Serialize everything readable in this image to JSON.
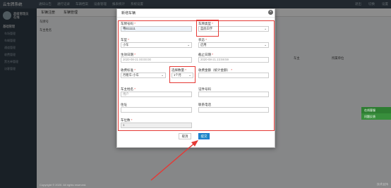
{
  "app": {
    "brand": "云车牌系统",
    "top_nav": [
      "通知公告",
      "通行记录",
      "车辆档案",
      "设备管理",
      "报表统计",
      "系统设置"
    ],
    "top_right": [
      "退出",
      "切换",
      "设置"
    ]
  },
  "sidebar": {
    "user_name": "超级管理员",
    "user_status": "在线",
    "section": "基础管理",
    "items": [
      "车场管理",
      "车辆管理",
      "通道管理",
      "收费管理",
      "黑名单管理",
      "访客管理"
    ]
  },
  "tabs": [
    "车辆注册",
    "车辆管理"
  ],
  "background": {
    "labels": [
      "车牌号",
      "车主姓名",
      "车主",
      "所属单位"
    ],
    "footer_left": "Copyright © 2020. All rights reserved.",
    "footer_right": "技术支持"
  },
  "float_buttons": [
    "在线客服",
    "问题反馈"
  ],
  "modal": {
    "title": "新增车辆",
    "close_glyph": "×",
    "fields": {
      "plate": {
        "label": "车牌号码",
        "value": "粤B11111"
      },
      "plate_type": {
        "label": "车牌类型",
        "value": "蓝底白字"
      },
      "car_type": {
        "label": "车型",
        "value": "小车"
      },
      "status": {
        "label": "状态",
        "value": "启用"
      },
      "start_date": {
        "label": "生效日期",
        "value": "2020-08-21 00:00:00"
      },
      "end_date": {
        "label": "截止日期",
        "value": "2020-08-21 23:59:59"
      },
      "fee_std": {
        "label": "收费标准",
        "value": "月租车-小车"
      },
      "pick_count": {
        "label": "选择数量",
        "value": "1个月"
      },
      "fee_amount": {
        "label": "收费金额（统计金额）",
        "value": ""
      },
      "owner_name": {
        "label": "车主姓名",
        "value": "用户"
      },
      "id_number": {
        "label": "证件号码",
        "value": ""
      },
      "address": {
        "label": "住址",
        "value": ""
      },
      "phone": {
        "label": "联系电话",
        "value": ""
      },
      "spots": {
        "label": "车位数",
        "value": "1"
      }
    },
    "cancel_label": "取消",
    "submit_label": "提交"
  }
}
